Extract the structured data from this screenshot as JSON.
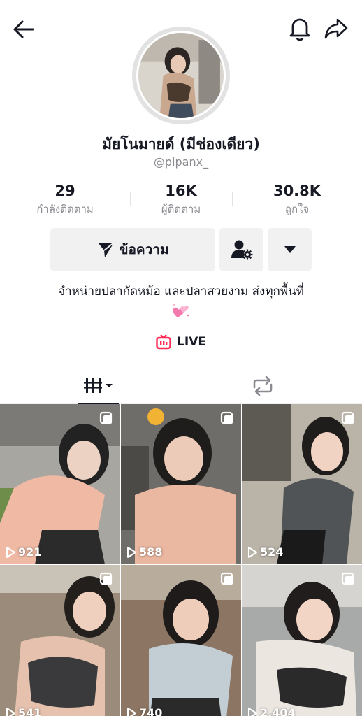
{
  "profile": {
    "display_name": "มัยโนมายด์ (มีช่องเดียว)",
    "username": "@pipanx_"
  },
  "stats": [
    {
      "value": "29",
      "label": "กำลังติดตาม"
    },
    {
      "value": "16K",
      "label": "ผู้ติดตาม"
    },
    {
      "value": "30.8K",
      "label": "ถูกใจ"
    }
  ],
  "actions": {
    "message_label": "ข้อความ"
  },
  "bio": {
    "text": "จำหน่ายปลากัดหม้อ และปลาสวยงาม ส่งทุกพื้นที่",
    "emoji": "💞"
  },
  "live": {
    "label": "LIVE"
  },
  "icons": {
    "back": "arrow-left-icon",
    "bell": "bell-icon",
    "share": "share-arrow-icon",
    "send": "paper-plane-icon",
    "add_friend": "person-gear-icon",
    "more": "caret-down-icon",
    "live": "tv-icon",
    "grid_tab": "grid-bars-icon",
    "repost_tab": "repost-icon",
    "multi": "multi-photo-icon",
    "play": "play-icon"
  },
  "colors": {
    "live_accent": "#fe2c55",
    "text": "#161823",
    "muted": "#8a8b91",
    "button_bg": "#f1f1f2"
  },
  "videos": [
    {
      "views": "921"
    },
    {
      "views": "588"
    },
    {
      "views": "524"
    },
    {
      "views": "541"
    },
    {
      "views": "740"
    },
    {
      "views": "2,404"
    }
  ]
}
